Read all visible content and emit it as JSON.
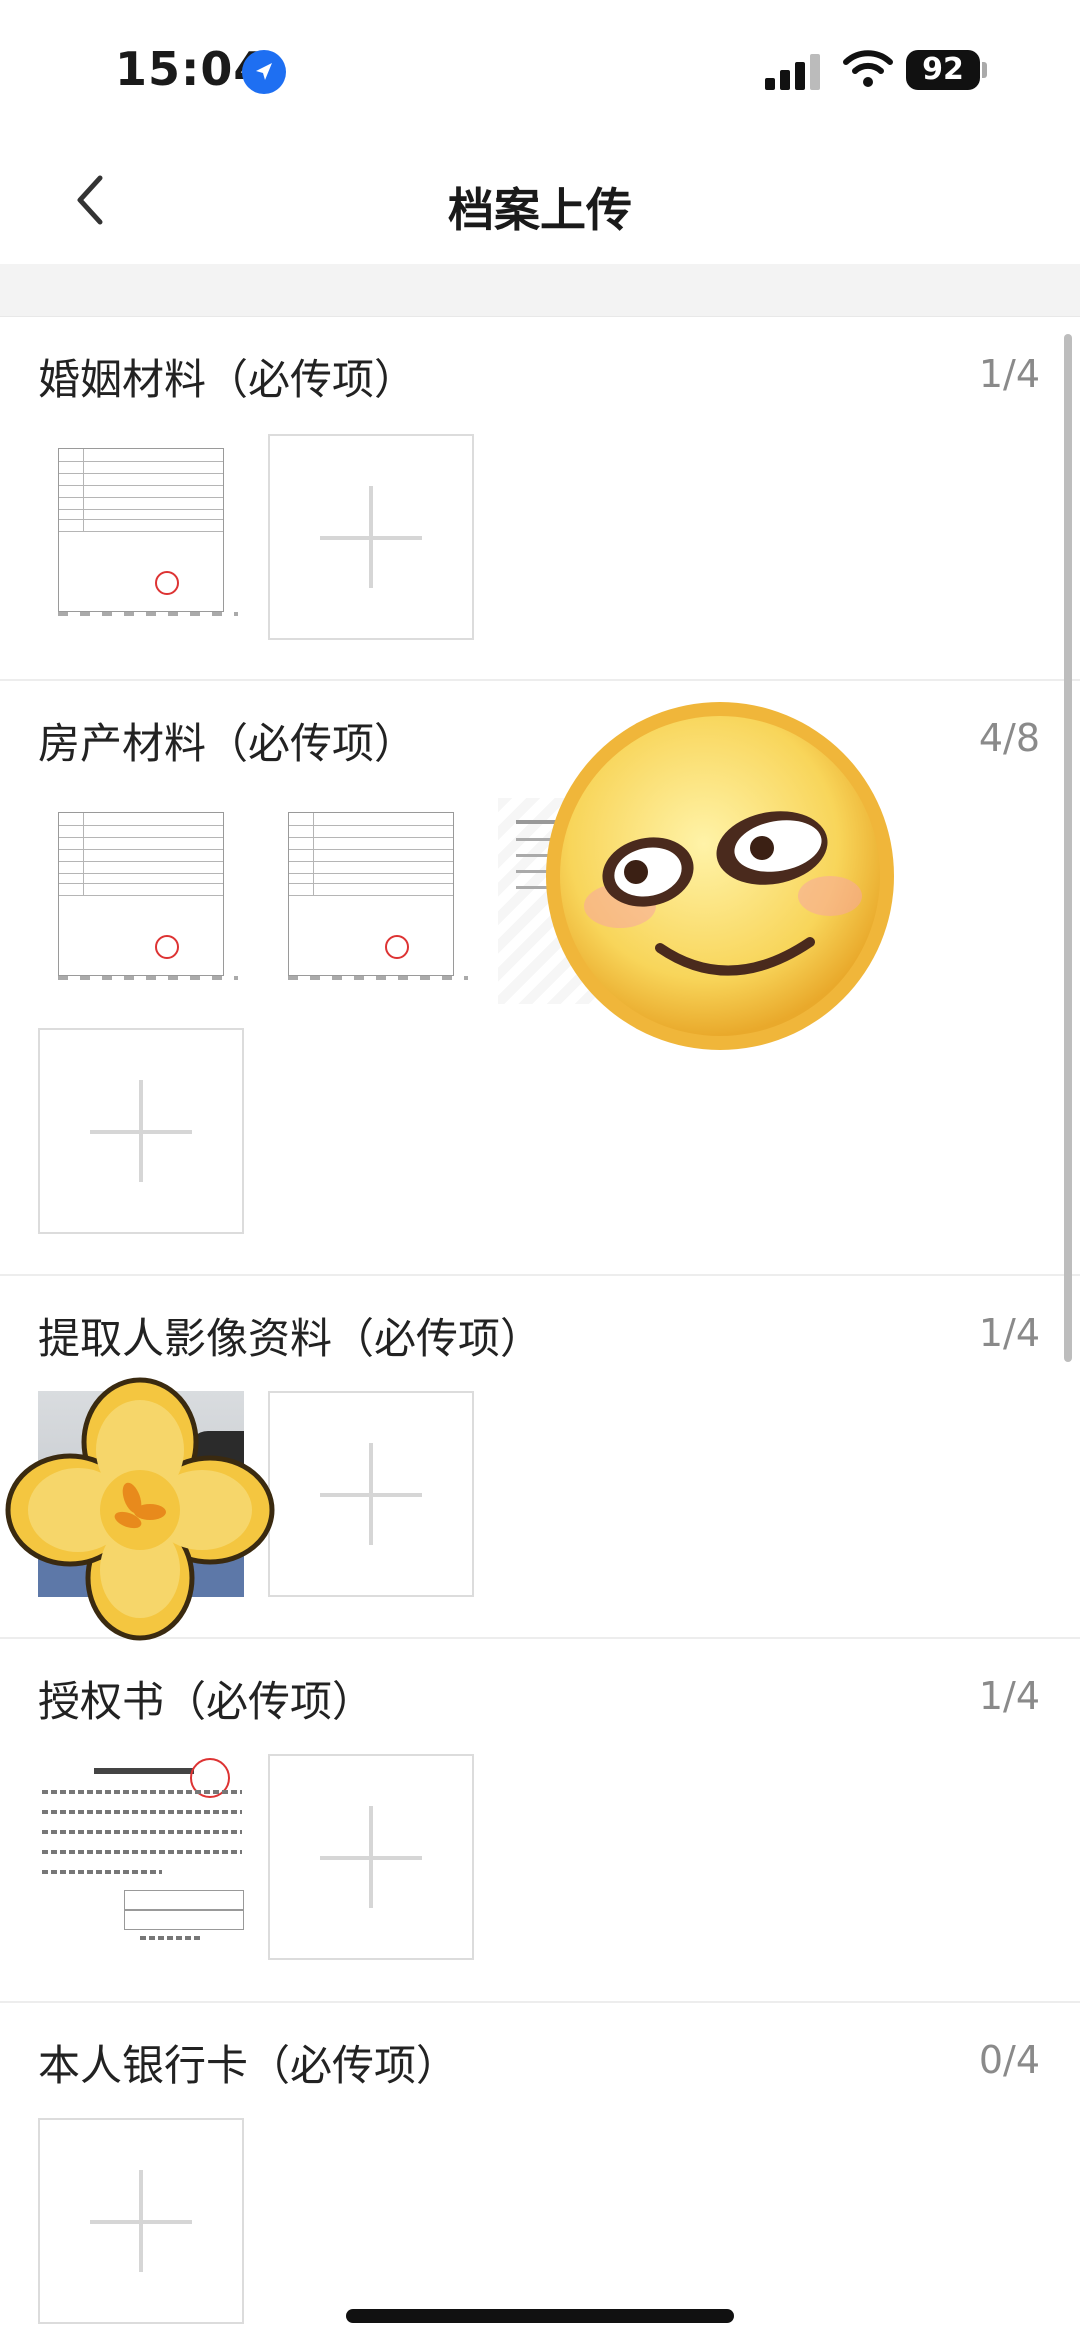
{
  "status_bar": {
    "time": "15:04",
    "battery": "92"
  },
  "nav": {
    "title": "档案上传"
  },
  "sections": [
    {
      "title": "婚姻材料（必传项）",
      "count": "1/4"
    },
    {
      "title": "房产材料（必传项）",
      "count": "4/8"
    },
    {
      "title": "提取人影像资料（必传项）",
      "count": "1/4"
    },
    {
      "title": "授权书（必传项）",
      "count": "1/4"
    },
    {
      "title": "本人银行卡（必传项）",
      "count": "0/4"
    }
  ],
  "icons": {
    "back": "chevron-left-icon",
    "add": "plus-icon",
    "location": "location-arrow-icon",
    "sticker_1": "smirk-emoji-sticker",
    "sticker_2": "yellow-flower-sticker"
  },
  "colors": {
    "accent_blue": "#1e6ff2",
    "divider": "#ededed",
    "count_gray": "#8a8a8a",
    "seal_red": "#d33333"
  }
}
